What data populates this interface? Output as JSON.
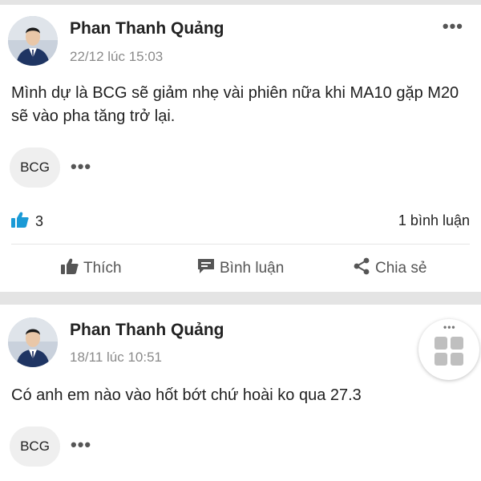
{
  "posts": [
    {
      "author": "Phan Thanh Quảng",
      "time": "22/12 lúc 15:03",
      "text": "Mình dự là BCG sẽ giảm nhẹ vài phiên nữa khi MA10 gặp M20 sẽ vào pha tăng trở lại.",
      "tag": "BCG",
      "likes": "3",
      "comments": "1 bình luận",
      "actions": {
        "like": "Thích",
        "comment": "Bình luận",
        "share": "Chia sẻ"
      }
    },
    {
      "author": "Phan Thanh Quảng",
      "time": "18/11 lúc 10:51",
      "text": "Có anh em nào vào hốt bớt chứ hoài ko qua 27.3",
      "tag": "BCG"
    }
  ],
  "icons": {
    "more": "more-horizontal-icon",
    "like_reaction": "thumbs-up-icon",
    "comment": "speech-bubble-icon",
    "share": "share-icon",
    "apps": "grid-icon"
  },
  "colors": {
    "like_blue": "#1a9ad6",
    "action_gray": "#555555",
    "separator": "#e4e4e4"
  }
}
